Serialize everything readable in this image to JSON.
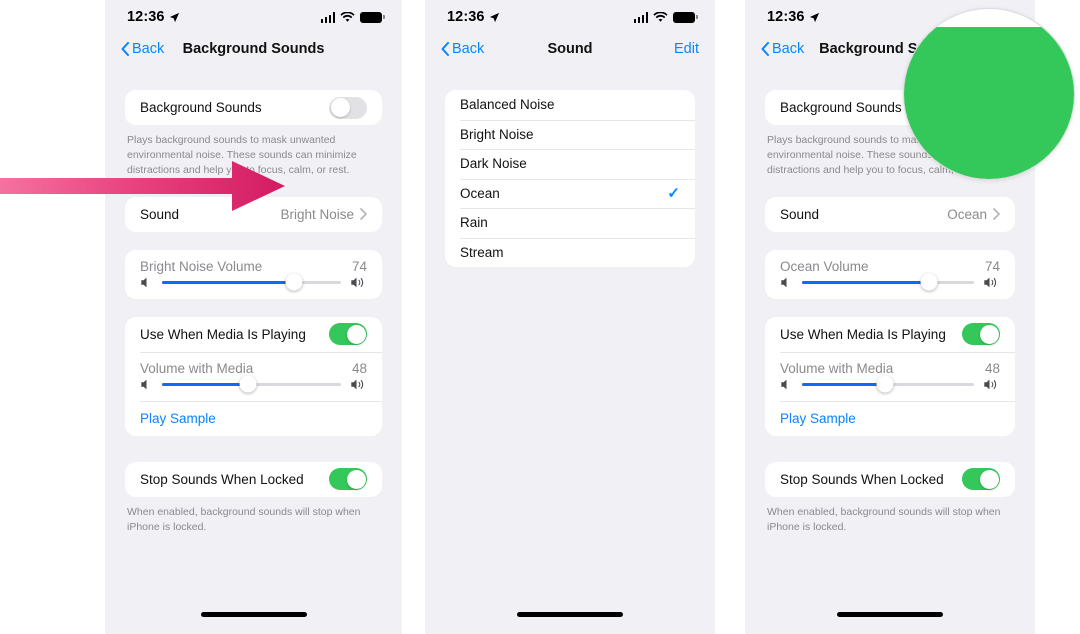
{
  "statusbar": {
    "time": "12:36",
    "location_icon": "location-arrow-icon",
    "signal_icon": "cellular-signal-icon",
    "wifi_icon": "wifi-icon",
    "battery_icon": "battery-icon"
  },
  "panel1": {
    "nav": {
      "back_label": "Back",
      "title": "Background Sounds",
      "back_icon": "chevron-left-icon"
    },
    "background_sounds": {
      "label": "Background Sounds",
      "toggle_state": "off"
    },
    "footnote": "Plays background sounds to mask unwanted environmental noise. These sounds can minimize distractions and help you to focus, calm, or rest.",
    "sound_row": {
      "label": "Sound",
      "value": "Bright Noise",
      "chevron_icon": "chevron-right-icon"
    },
    "volume": {
      "label": "Bright Noise Volume",
      "value": "74",
      "percent": 74,
      "low_icon": "speaker-low-icon",
      "high_icon": "speaker-high-icon"
    },
    "use_when_media": {
      "label": "Use When Media Is Playing",
      "toggle_state": "on"
    },
    "media_volume": {
      "label": "Volume with Media",
      "value": "48",
      "percent": 48,
      "low_icon": "speaker-low-icon",
      "high_icon": "speaker-high-icon"
    },
    "play_sample": "Play Sample",
    "stop_when_locked": {
      "label": "Stop Sounds When Locked",
      "toggle_state": "on"
    },
    "stop_footnote": "When enabled, background sounds will stop when iPhone is locked."
  },
  "panel2": {
    "nav": {
      "back_label": "Back",
      "title": "Sound",
      "edit_label": "Edit",
      "back_icon": "chevron-left-icon"
    },
    "options": [
      {
        "label": "Balanced Noise",
        "selected": false
      },
      {
        "label": "Bright Noise",
        "selected": false
      },
      {
        "label": "Dark Noise",
        "selected": false
      },
      {
        "label": "Ocean",
        "selected": true
      },
      {
        "label": "Rain",
        "selected": false
      },
      {
        "label": "Stream",
        "selected": false
      }
    ],
    "check_icon": "checkmark-icon"
  },
  "panel3": {
    "nav": {
      "back_label": "Back",
      "title": "Background Sounds",
      "back_icon": "chevron-left-icon"
    },
    "background_sounds": {
      "label": "Background Sounds",
      "toggle_state": "on"
    },
    "footnote": "Plays background sounds to mask unwanted environmental noise. These sounds can minimize distractions and help you to focus, calm, or rest.",
    "sound_row": {
      "label": "Sound",
      "value": "Ocean",
      "chevron_icon": "chevron-right-icon"
    },
    "volume": {
      "label": "Ocean Volume",
      "value": "74",
      "percent": 74,
      "low_icon": "speaker-low-icon",
      "high_icon": "speaker-high-icon"
    },
    "use_when_media": {
      "label": "Use When Media Is Playing",
      "toggle_state": "on"
    },
    "media_volume": {
      "label": "Volume with Media",
      "value": "48",
      "percent": 48,
      "low_icon": "speaker-low-icon",
      "high_icon": "speaker-high-icon"
    },
    "play_sample": "Play Sample",
    "stop_when_locked": {
      "label": "Stop Sounds When Locked",
      "toggle_state": "on"
    },
    "stop_footnote": "When enabled, background sounds will stop when iPhone is locked."
  },
  "annotations": {
    "arrow": {
      "name": "pink-pointer-arrow",
      "color_start": "#f472a0",
      "color_end": "#d31b62",
      "points_to": "Sound row"
    },
    "magnifier": {
      "name": "magnifier-callout",
      "shows": "Background Sounds toggle enabled",
      "toggle_color": "#34c759"
    }
  },
  "colors": {
    "accent_blue": "#0a84ff",
    "slider_blue": "#0a6cff",
    "toggle_green": "#34c759",
    "screen_bg": "#f1f1f5",
    "card_bg": "#ffffff"
  }
}
